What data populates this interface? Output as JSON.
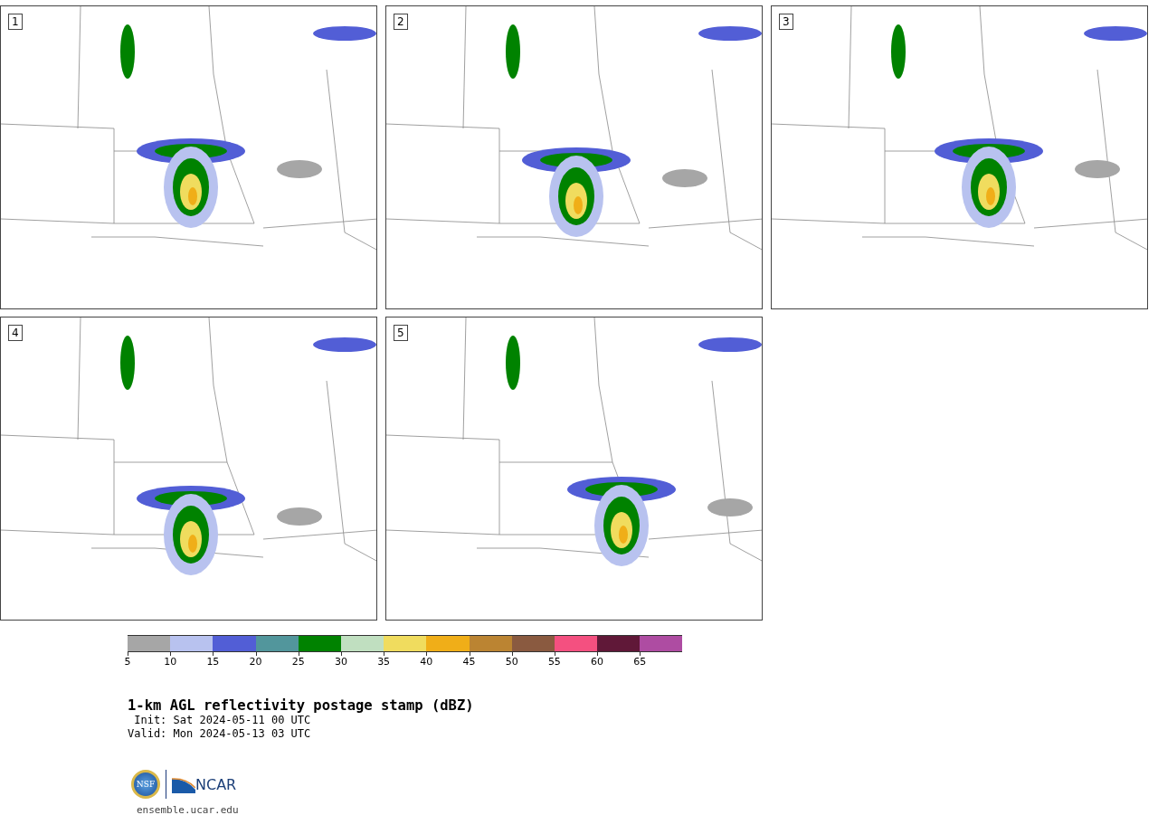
{
  "panels": [
    {
      "number": "1"
    },
    {
      "number": "2"
    },
    {
      "number": "3"
    },
    {
      "number": "4"
    },
    {
      "number": "5"
    }
  ],
  "colorbar": {
    "segments": [
      {
        "color": "#a6a6a6",
        "label": "5"
      },
      {
        "color": "#b8c2ef",
        "label": "10"
      },
      {
        "color": "#525ed6",
        "label": "15"
      },
      {
        "color": "#52969c",
        "label": "20"
      },
      {
        "color": "#008200",
        "label": "25"
      },
      {
        "color": "#c0dfc0",
        "label": "30"
      },
      {
        "color": "#f0dc5e",
        "label": "35"
      },
      {
        "color": "#f0ae18",
        "label": "40"
      },
      {
        "color": "#bb8432",
        "label": "45"
      },
      {
        "color": "#8a5a40",
        "label": "50"
      },
      {
        "color": "#f45080",
        "label": "55"
      },
      {
        "color": "#601838",
        "label": "60"
      },
      {
        "color": "#ae4ca2",
        "label": "65"
      }
    ]
  },
  "title": "1-km AGL reflectivity postage stamp (dBZ)",
  "init": " Init: Sat 2024-05-11 00 UTC",
  "valid": "Valid: Mon 2024-05-13 03 UTC",
  "logos": {
    "nsf": "NSF",
    "ncar": "NCAR"
  },
  "footer": "ensemble.ucar.edu"
}
